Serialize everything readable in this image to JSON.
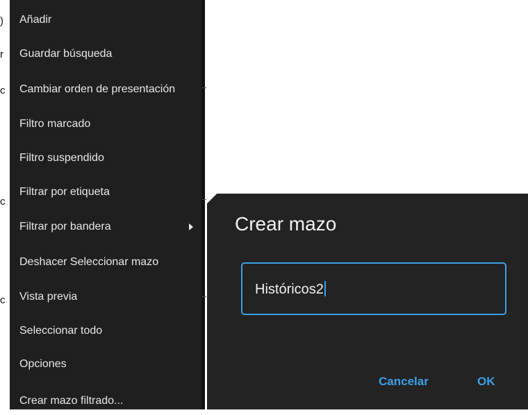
{
  "menu": {
    "items": [
      {
        "label": "Añadir",
        "submenu": false
      },
      {
        "label": "Guardar búsqueda",
        "submenu": false
      },
      {
        "label": "Cambiar orden de presentación",
        "submenu": false
      },
      {
        "label": "Filtro marcado",
        "submenu": false
      },
      {
        "label": "Filtro suspendido",
        "submenu": false
      },
      {
        "label": "Filtrar por etiqueta",
        "submenu": false
      },
      {
        "label": "Filtrar por bandera",
        "submenu": true
      },
      {
        "label": "Deshacer Seleccionar mazo",
        "submenu": false
      },
      {
        "label": "Vista previa",
        "submenu": false
      },
      {
        "label": "Seleccionar todo",
        "submenu": false
      },
      {
        "label": "Opciones",
        "submenu": false
      },
      {
        "label": "Crear mazo filtrado...",
        "submenu": false
      }
    ]
  },
  "dialog": {
    "title": "Crear mazo",
    "input_value": "Históricos2",
    "cancel_label": "Cancelar",
    "ok_label": "OK"
  },
  "colors": {
    "menu_bg": "#1f1f1f",
    "dialog_bg": "#232323",
    "accent": "#3aa0e8",
    "text": "#e8e8e8"
  }
}
